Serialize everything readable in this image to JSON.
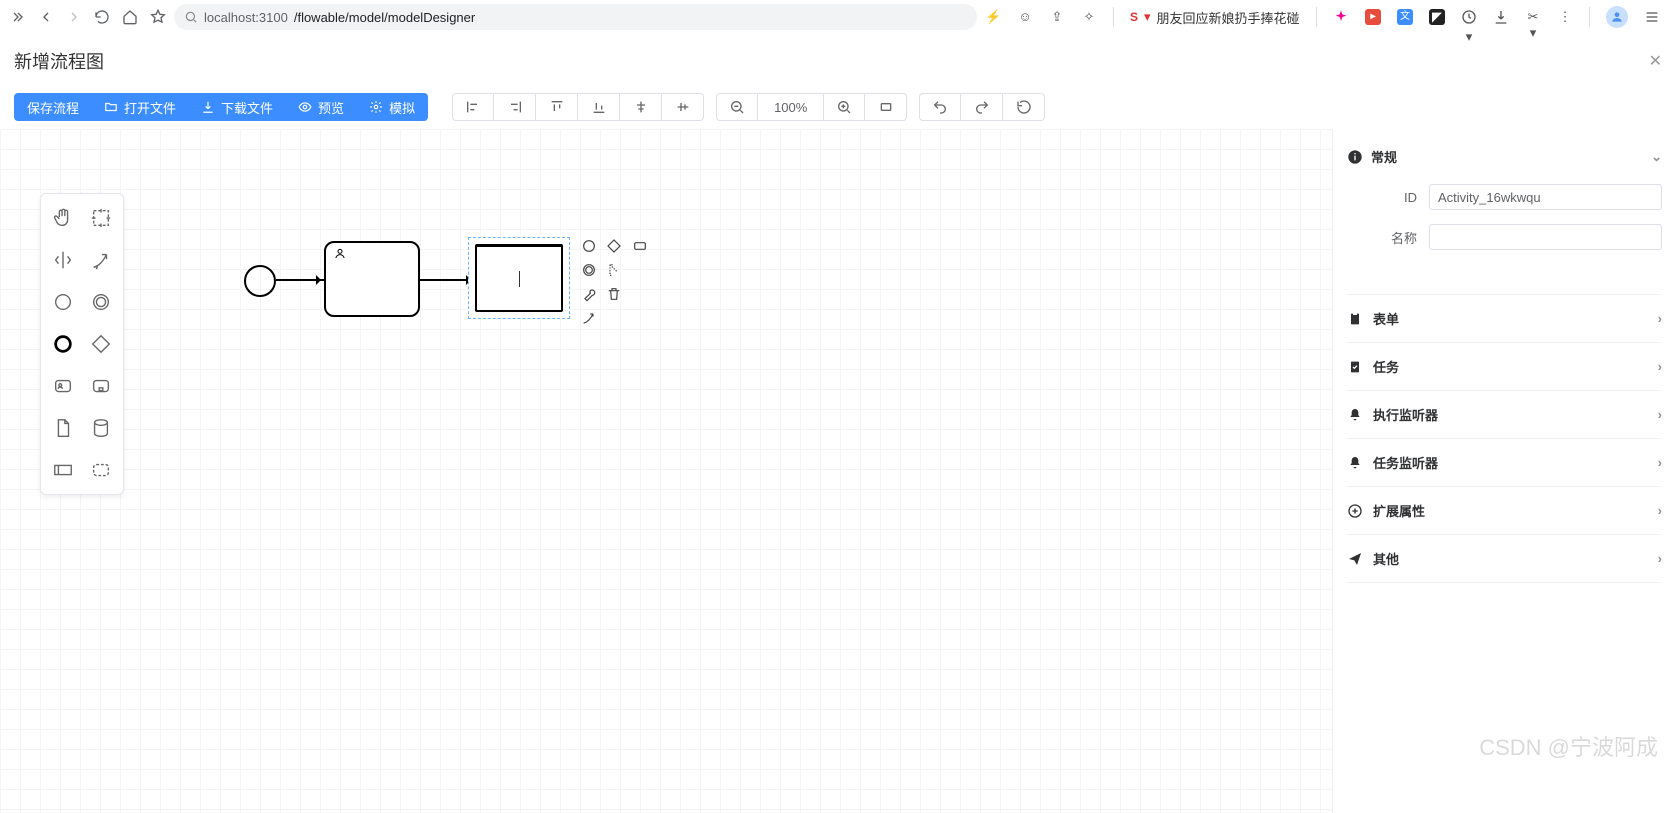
{
  "browser": {
    "url_prefix": "localhost:3100",
    "url_path": "/flowable/model/modelDesigner",
    "bookmark": {
      "icon_label": "S",
      "title": "朋友回应新娘扔手捧花碰伤"
    }
  },
  "page": {
    "title": "新增流程图"
  },
  "toolbar": {
    "save_label": "保存流程",
    "open_label": "打开文件",
    "download_label": "下载文件",
    "preview_label": "预览",
    "simulate_label": "模拟",
    "zoom": "100%"
  },
  "properties": {
    "section_general": "常规",
    "id_label": "ID",
    "id_value": "Activity_16wkwqu",
    "name_label": "名称",
    "name_value": "",
    "sections": [
      {
        "icon": "clipboard",
        "label": "表单"
      },
      {
        "icon": "clipboard-check",
        "label": "任务"
      },
      {
        "icon": "bell",
        "label": "执行监听器"
      },
      {
        "icon": "bell",
        "label": "任务监听器"
      },
      {
        "icon": "plus-circle",
        "label": "扩展属性"
      },
      {
        "icon": "send",
        "label": "其他"
      }
    ]
  },
  "watermark": "CSDN @宁波阿成"
}
